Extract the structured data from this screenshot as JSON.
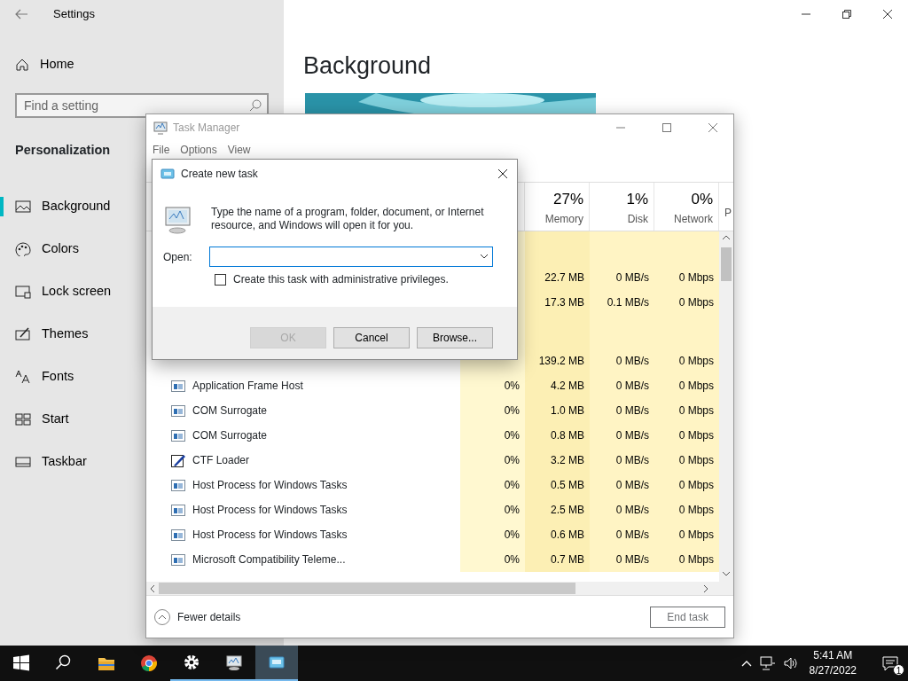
{
  "settings": {
    "title": "Settings",
    "home": "Home",
    "search": {
      "placeholder": "Find a setting"
    },
    "section": "Personalization",
    "nav": [
      {
        "label": "Background",
        "selected": true
      },
      {
        "label": "Colors",
        "selected": false
      },
      {
        "label": "Lock screen",
        "selected": false
      },
      {
        "label": "Themes",
        "selected": false
      },
      {
        "label": "Fonts",
        "selected": false
      },
      {
        "label": "Start",
        "selected": false
      },
      {
        "label": "Taskbar",
        "selected": false
      }
    ],
    "page_title": "Background"
  },
  "task_manager": {
    "title": "Task Manager",
    "menu": [
      "File",
      "Options",
      "View"
    ],
    "columns": [
      {
        "value": "27%",
        "label": "Memory"
      },
      {
        "value": "1%",
        "label": "Disk"
      },
      {
        "value": "0%",
        "label": "Network"
      }
    ],
    "column_6": "P",
    "rows": [
      {
        "kind": "group"
      },
      {
        "kind": "hidden",
        "memory": "22.7 MB",
        "disk": "0 MB/s",
        "network": "0 Mbps"
      },
      {
        "kind": "hidden",
        "memory": "17.3 MB",
        "disk": "0.1 MB/s",
        "network": "0 Mbps"
      },
      {
        "kind": "group"
      },
      {
        "kind": "hidden",
        "memory": "139.2 MB",
        "disk": "0 MB/s",
        "network": "0 Mbps"
      },
      {
        "kind": "service",
        "name": "Application Frame Host",
        "cpu": "0%",
        "memory": "4.2 MB",
        "disk": "0 MB/s",
        "network": "0 Mbps"
      },
      {
        "kind": "service",
        "name": "COM Surrogate",
        "cpu": "0%",
        "memory": "1.0 MB",
        "disk": "0 MB/s",
        "network": "0 Mbps"
      },
      {
        "kind": "service",
        "name": "COM Surrogate",
        "cpu": "0%",
        "memory": "0.8 MB",
        "disk": "0 MB/s",
        "network": "0 Mbps"
      },
      {
        "kind": "tool",
        "name": "CTF Loader",
        "cpu": "0%",
        "memory": "3.2 MB",
        "disk": "0 MB/s",
        "network": "0 Mbps"
      },
      {
        "kind": "service",
        "name": "Host Process for Windows Tasks",
        "cpu": "0%",
        "memory": "0.5 MB",
        "disk": "0 MB/s",
        "network": "0 Mbps"
      },
      {
        "kind": "service",
        "name": "Host Process for Windows Tasks",
        "cpu": "0%",
        "memory": "2.5 MB",
        "disk": "0 MB/s",
        "network": "0 Mbps"
      },
      {
        "kind": "service",
        "name": "Host Process for Windows Tasks",
        "cpu": "0%",
        "memory": "0.6 MB",
        "disk": "0 MB/s",
        "network": "0 Mbps"
      },
      {
        "kind": "service",
        "name": "Microsoft Compatibility Teleme...",
        "cpu": "0%",
        "memory": "0.7 MB",
        "disk": "0 MB/s",
        "network": "0 Mbps"
      }
    ],
    "fewer_details": "Fewer details",
    "end_task": {
      "label": "End task",
      "disabled": true
    }
  },
  "dialog": {
    "title": "Create new task",
    "message": "Type the name of a program, folder, document, or Internet resource, and Windows will open it for you.",
    "open_label": "Open:",
    "checkbox": {
      "label": "Create this task with administrative privileges.",
      "checked": false
    },
    "buttons": [
      {
        "label": "OK",
        "disabled": true
      },
      {
        "label": "Cancel",
        "disabled": false
      },
      {
        "label": "Browse...",
        "disabled": false
      }
    ]
  },
  "taskbar": {
    "apps": [
      {
        "kind": "start",
        "running": false,
        "active": false
      },
      {
        "kind": "search",
        "running": false,
        "active": false
      },
      {
        "kind": "folder",
        "running": false,
        "active": false
      },
      {
        "kind": "browser",
        "running": false,
        "active": false
      },
      {
        "kind": "gear",
        "running": true,
        "active": false
      },
      {
        "kind": "monitor",
        "running": true,
        "active": false
      },
      {
        "kind": "run",
        "running": true,
        "active": true
      }
    ],
    "time": "5:41 AM",
    "date": "8/27/2022",
    "notifications": "1"
  }
}
